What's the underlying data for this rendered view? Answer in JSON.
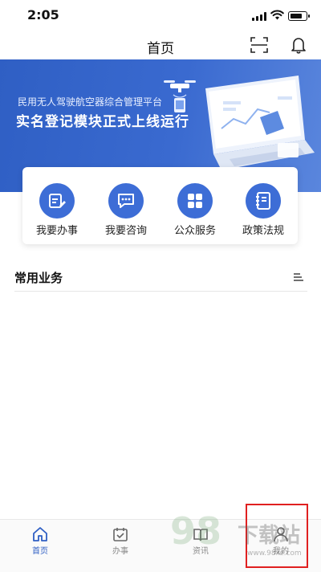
{
  "status_bar": {
    "time": "2:05",
    "battery_level": 0.8
  },
  "header": {
    "title": "首页",
    "scan_icon": "scan-icon",
    "bell_icon": "bell-icon"
  },
  "banner": {
    "line1": "民用无人驾驶航空器综合管理平台",
    "line2": "实名登记模块正式上线运行",
    "colors": {
      "start": "#2f5fc4",
      "end": "#5a86dd"
    }
  },
  "quick_actions": [
    {
      "label": "我要办事",
      "icon": "edit-icon"
    },
    {
      "label": "我要咨询",
      "icon": "chat-icon"
    },
    {
      "label": "公众服务",
      "icon": "grid-icon"
    },
    {
      "label": "政策法规",
      "icon": "book-icon"
    }
  ],
  "section": {
    "title": "常用业务",
    "icon": "list-menu-icon"
  },
  "tabbar": {
    "active": 0,
    "items": [
      {
        "label": "首页",
        "icon": "home-icon"
      },
      {
        "label": "办事",
        "icon": "calendar-check-icon"
      },
      {
        "label": "资讯",
        "icon": "news-icon"
      },
      {
        "label": "我的",
        "icon": "user-icon"
      }
    ]
  },
  "watermark": {
    "number": "98",
    "text": "下载站",
    "url": "www.98xz.com"
  },
  "accent_color": "#3d6dd6",
  "highlight_color": "#e02020"
}
